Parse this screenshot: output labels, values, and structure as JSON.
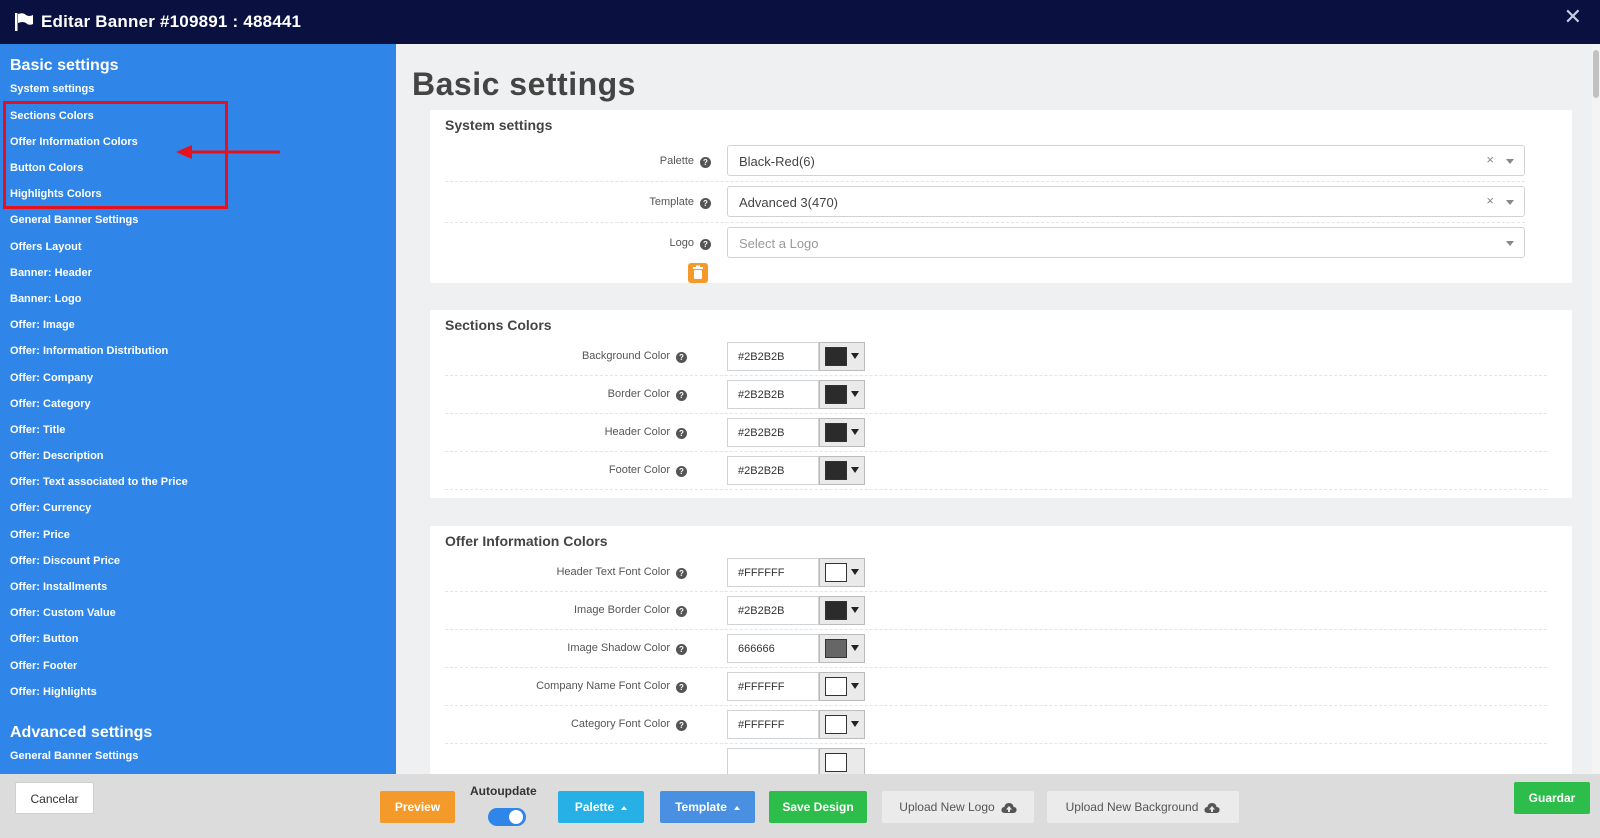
{
  "window": {
    "title": "Editar Banner #109891 : 488441"
  },
  "sidebar": {
    "basic_heading": "Basic settings",
    "basic_items": [
      "System settings",
      "Sections Colors",
      "Offer Information Colors",
      "Button Colors",
      "Highlights Colors",
      "General Banner Settings",
      "Offers Layout",
      "Banner: Header",
      "Banner: Logo",
      "Offer: Image",
      "Offer: Information Distribution",
      "Offer: Company",
      "Offer: Category",
      "Offer: Title",
      "Offer: Description",
      "Offer: Text associated to the Price",
      "Offer: Currency",
      "Offer: Price",
      "Offer: Discount Price",
      "Offer: Installments",
      "Offer: Custom Value",
      "Offer: Button",
      "Offer: Footer",
      "Offer: Highlights"
    ],
    "advanced_heading": "Advanced settings",
    "advanced_items": [
      "General Banner Settings"
    ]
  },
  "main": {
    "title": "Basic settings",
    "system": {
      "title": "System settings",
      "palette": {
        "label": "Palette",
        "value": "Black-Red(6)"
      },
      "template": {
        "label": "Template",
        "value": "Advanced 3(470)"
      },
      "logo": {
        "label": "Logo",
        "placeholder": "Select a Logo"
      }
    },
    "sections": {
      "title": "Sections Colors",
      "rows": [
        {
          "label": "Background Color",
          "value": "#2B2B2B",
          "swatch": "#2b2b2b"
        },
        {
          "label": "Border Color",
          "value": "#2B2B2B",
          "swatch": "#2b2b2b"
        },
        {
          "label": "Header Color",
          "value": "#2B2B2B",
          "swatch": "#2b2b2b"
        },
        {
          "label": "Footer Color",
          "value": "#2B2B2B",
          "swatch": "#2b2b2b"
        }
      ]
    },
    "offer_info": {
      "title": "Offer Information Colors",
      "rows": [
        {
          "label": "Header Text Font Color",
          "value": "#FFFFFF",
          "swatch": "#ffffff"
        },
        {
          "label": "Image Border Color",
          "value": "#2B2B2B",
          "swatch": "#2b2b2b"
        },
        {
          "label": "Image Shadow Color",
          "value": "666666",
          "swatch": "#666666"
        },
        {
          "label": "Company Name Font Color",
          "value": "#FFFFFF",
          "swatch": "#ffffff"
        },
        {
          "label": "Category Font Color",
          "value": "#FFFFFF",
          "swatch": "#ffffff"
        }
      ]
    }
  },
  "bottom": {
    "cancel": "Cancelar",
    "preview": "Preview",
    "autoupdate": "Autoupdate",
    "autoupdate_on": true,
    "palette": "Palette",
    "template": "Template",
    "save": "Save Design",
    "upload_logo": "Upload New Logo",
    "upload_bg": "Upload New Background",
    "guardar": "Guardar"
  }
}
